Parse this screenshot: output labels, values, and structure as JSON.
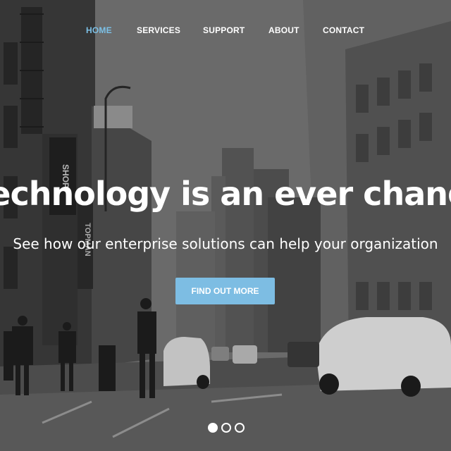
{
  "nav": {
    "items": [
      {
        "label": "HOME",
        "active": true
      },
      {
        "label": "SERVICES",
        "active": false
      },
      {
        "label": "SUPPORT",
        "active": false
      },
      {
        "label": "ABOUT",
        "active": false
      },
      {
        "label": "CONTACT",
        "active": false
      }
    ]
  },
  "hero": {
    "headline": "Technology is an ever changing market",
    "subheadline": "See how our enterprise solutions can help your organization",
    "cta_label": "FIND OUT MORE",
    "background": "grayscale city street photo",
    "signs": {
      "shop": "SHOP",
      "topman": "TOPMAN"
    }
  },
  "carousel": {
    "slide_count": 3,
    "active_index": 0
  },
  "colors": {
    "accent": "#7dbde3",
    "nav_active": "#7cc0e6",
    "text": "#ffffff"
  }
}
